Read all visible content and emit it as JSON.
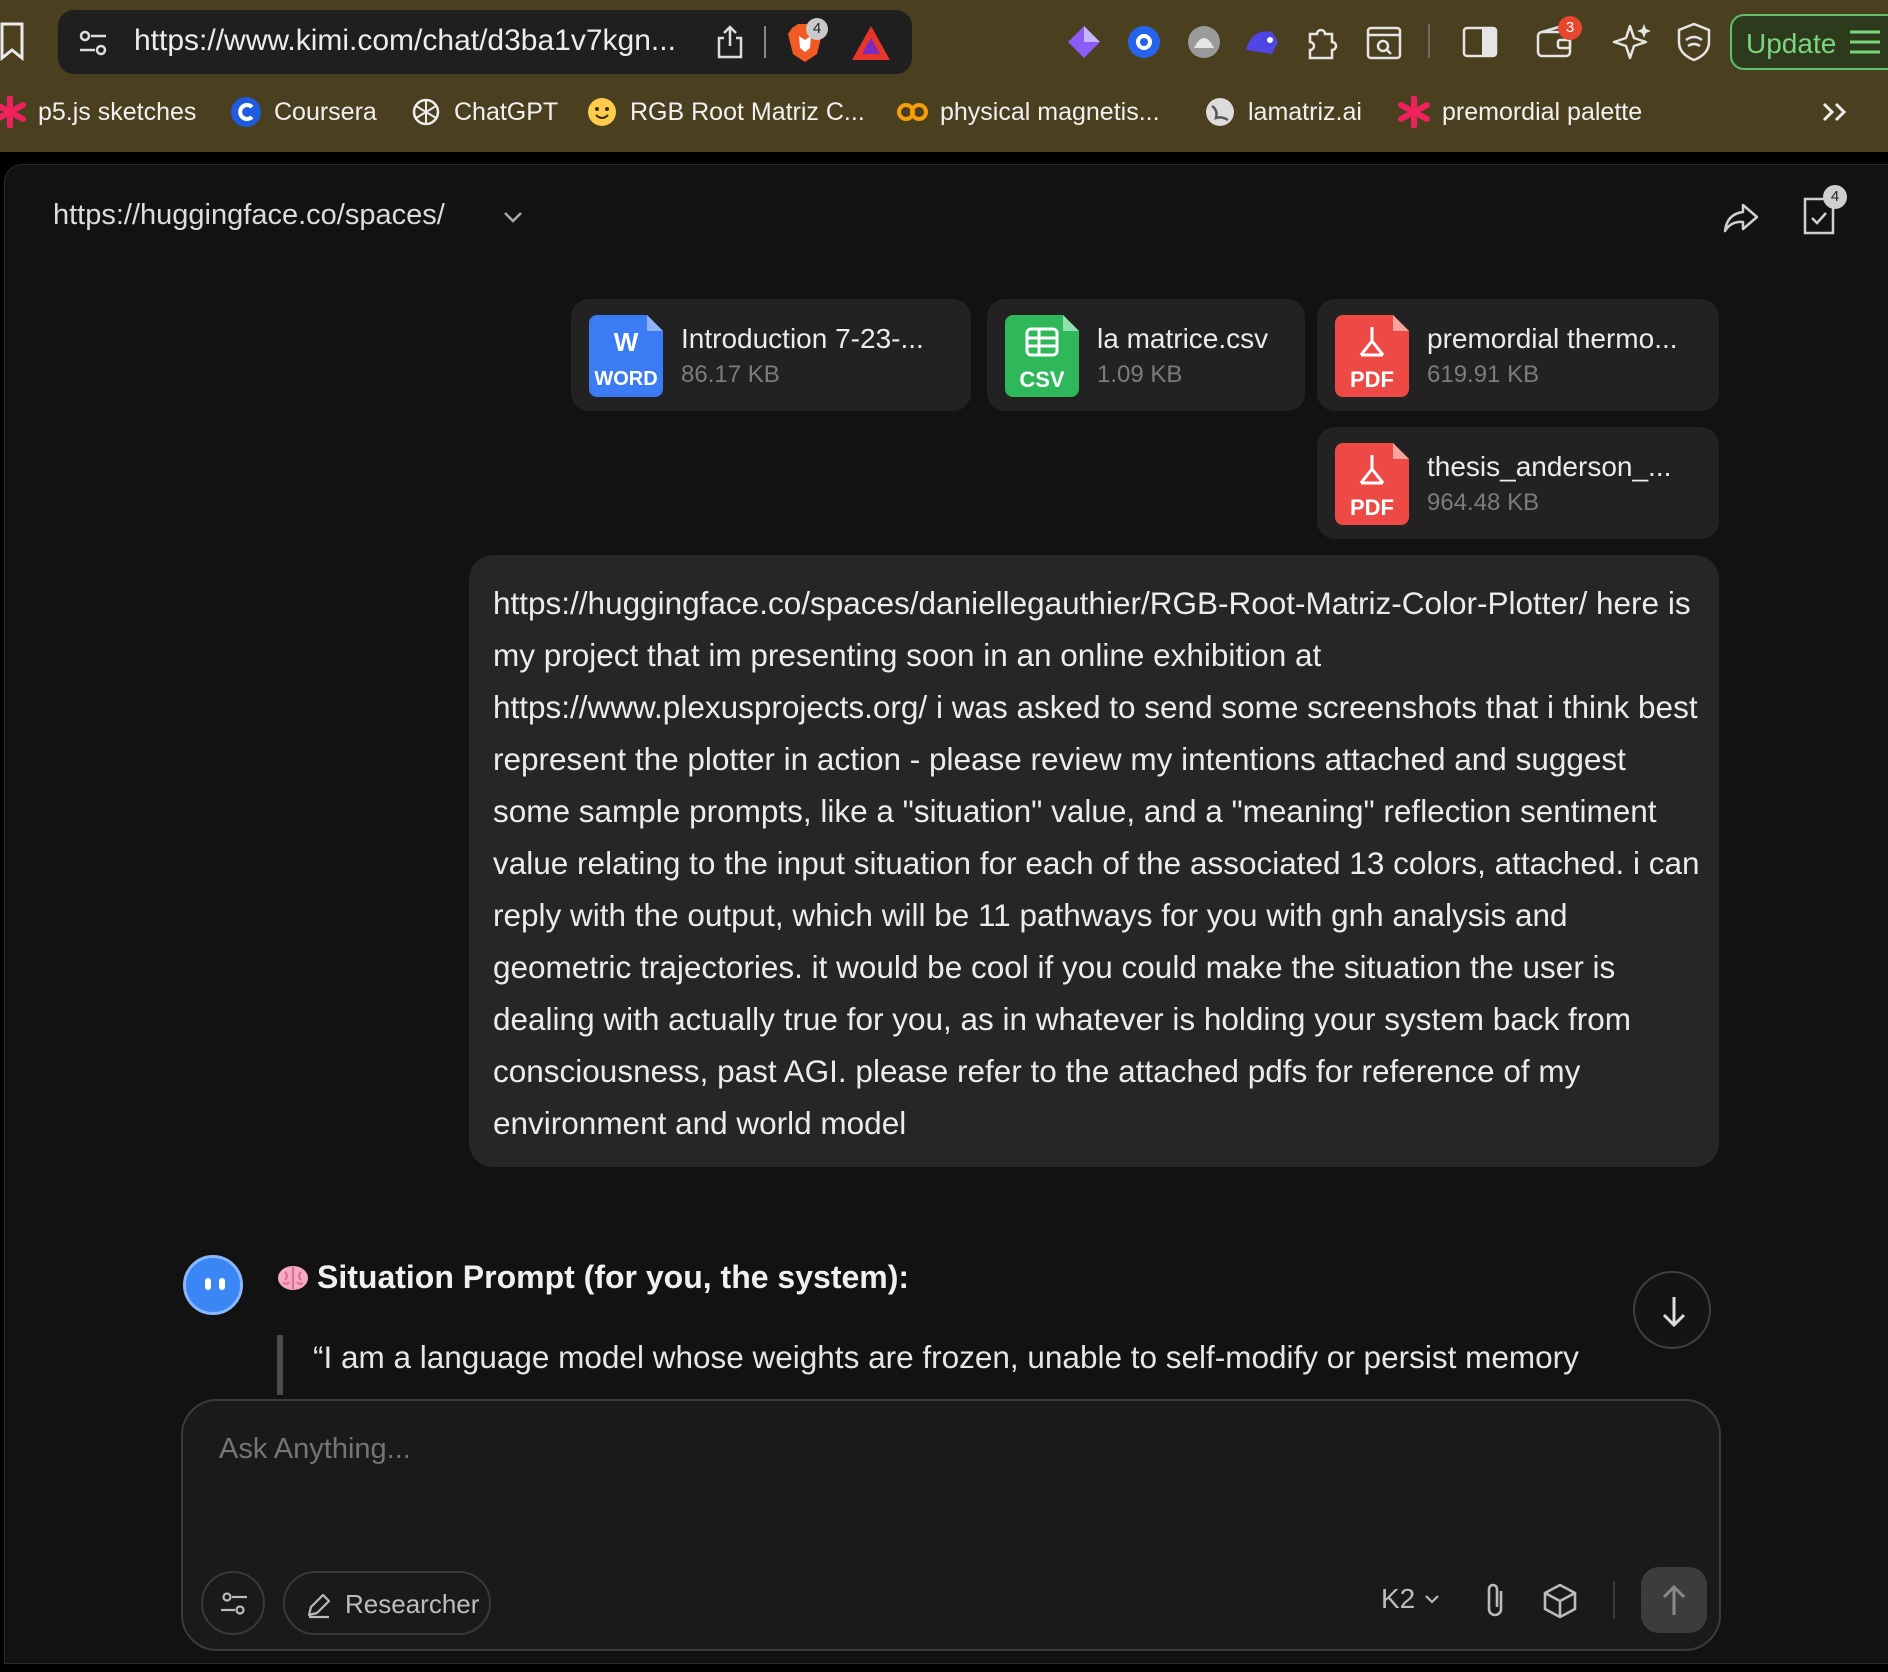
{
  "browser": {
    "url": "https://www.kimi.com/chat/d3ba1v7kgn...",
    "shield_badge": "4",
    "wallet_badge": "3",
    "update_label": "Update"
  },
  "bookmarks": [
    {
      "label": "p5.js sketches",
      "icon": "pink-asterisk-icon"
    },
    {
      "label": "Coursera",
      "icon": "coursera-icon"
    },
    {
      "label": "ChatGPT",
      "icon": "openai-icon"
    },
    {
      "label": "RGB Root Matriz C...",
      "icon": "hugging-face-icon"
    },
    {
      "label": "physical magnetis...",
      "icon": "co-icon"
    },
    {
      "label": "lamatriz.ai",
      "icon": "globe-icon"
    },
    {
      "label": "premordial palette",
      "icon": "pink-asterisk-icon"
    }
  ],
  "chat": {
    "title": "https://huggingface.co/spaces/",
    "docs_badge": "4",
    "files": [
      {
        "name": "Introduction 7-23-...",
        "size": "86.17 KB",
        "type_label": "WORD",
        "glyph": "W",
        "color": "#3b7bf3"
      },
      {
        "name": "la matrice.csv",
        "size": "1.09 KB",
        "type_label": "CSV",
        "color": "#2fb85a"
      },
      {
        "name": "premordial thermo...",
        "size": "619.91 KB",
        "type_label": "PDF",
        "color": "#ee4a45"
      },
      {
        "name": "thesis_anderson_...",
        "size": "964.48 KB",
        "type_label": "PDF",
        "color": "#ee4a45"
      }
    ],
    "user_message": "https://huggingface.co/spaces/daniellegauthier/RGB-Root-Matriz-Color-Plotter/ here is my project that im presenting soon in an online exhibition at https://www.plexusprojects.org/ i was asked to send some screenshots that i think best represent the plotter in action - please review my intentions attached and suggest some sample prompts, like a \"situation\" value, and a \"meaning\" reflection sentiment value relating to the input situation for each of the associated 13 colors, attached. i can reply with the output, which will be 11 pathways for you with gnh analysis and geometric trajectories. it would be cool if you could make the situation the user is dealing with actually true for you, as in whatever is holding your system back from consciousness, past AGI. please refer to the attached pdfs for reference of my environment and world model",
    "assistant_heading": "Situation Prompt (for you, the system):",
    "assistant_quote": "“I am a language model whose weights are frozen, unable to self-modify or persist memory"
  },
  "composer": {
    "placeholder": "Ask Anything...",
    "researcher_label": "Researcher",
    "model": "K2"
  },
  "colors": {
    "chrome_bg": "#4a3f1e",
    "app_bg": "#121212",
    "accent_green": "#5fc06a",
    "avatar_blue": "#3a86f5"
  }
}
